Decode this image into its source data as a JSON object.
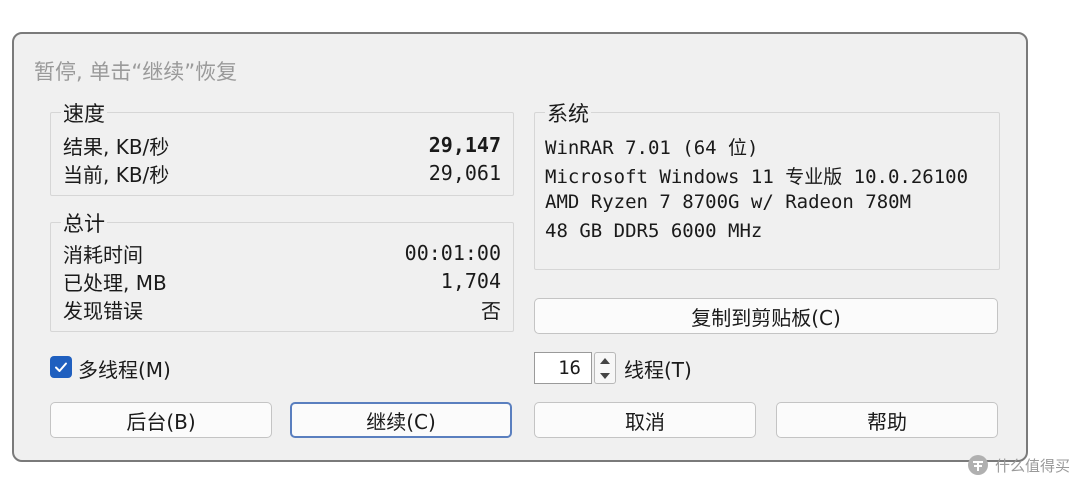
{
  "dialog": {
    "title": "暂停, 单击“继续”恢复"
  },
  "speed": {
    "legend": "速度",
    "result_label": "结果, KB/秒",
    "result_value": "29,147",
    "current_label": "当前, KB/秒",
    "current_value": "29,061"
  },
  "total": {
    "legend": "总计",
    "elapsed_label": "消耗时间",
    "elapsed_value": "00:01:00",
    "processed_label": "已处理, MB",
    "processed_value": "1,704",
    "errors_label": "发现错误",
    "errors_value": "否"
  },
  "system": {
    "legend": "系统",
    "lines": [
      "WinRAR 7.01 (64 位)",
      "Microsoft Windows 11 专业版 10.0.26100",
      "AMD Ryzen 7 8700G w/ Radeon 780M",
      "48 GB DDR5 6000 MHz"
    ]
  },
  "copy_button": "复制到剪贴板(C)",
  "multithread": {
    "label": "多线程(M)",
    "checked": true
  },
  "threads": {
    "value": "16",
    "label": "线程(T)"
  },
  "buttons": {
    "background": "后台(B)",
    "continue": "继续(C)",
    "cancel": "取消",
    "help": "帮助"
  },
  "watermark": {
    "text": "什么值得买"
  },
  "colors": {
    "accent": "#1f5fbf",
    "dialog_bg": "#f0f0f0",
    "title_text": "#9a9a9a"
  }
}
